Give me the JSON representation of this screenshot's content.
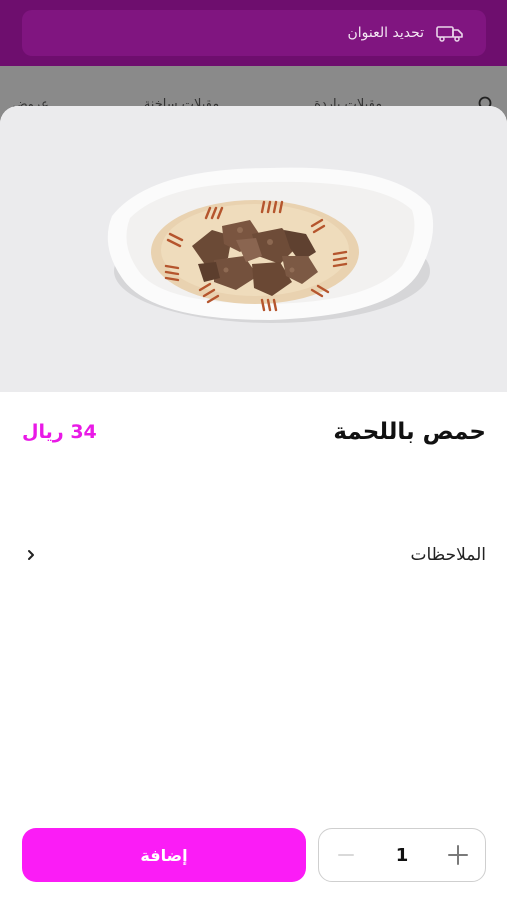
{
  "header": {
    "address_label": "تحديد العنوان",
    "icon": "delivery-truck-icon"
  },
  "categories": {
    "items": [
      "مقبلات باردة",
      "مقبلات ساخنة",
      "عروض"
    ],
    "search_icon": "search-icon"
  },
  "product": {
    "name": "حمص باللحمة",
    "price": "34 ريال",
    "image_alt": "hummus-with-meat-photo"
  },
  "notes": {
    "label": "الملاحظات",
    "icon": "chevron-right-icon"
  },
  "actions": {
    "add_label": "إضافة",
    "quantity": "1"
  },
  "colors": {
    "header": "#6e0e6e",
    "accent": "#fb1cf6",
    "price": "#e919e6"
  }
}
